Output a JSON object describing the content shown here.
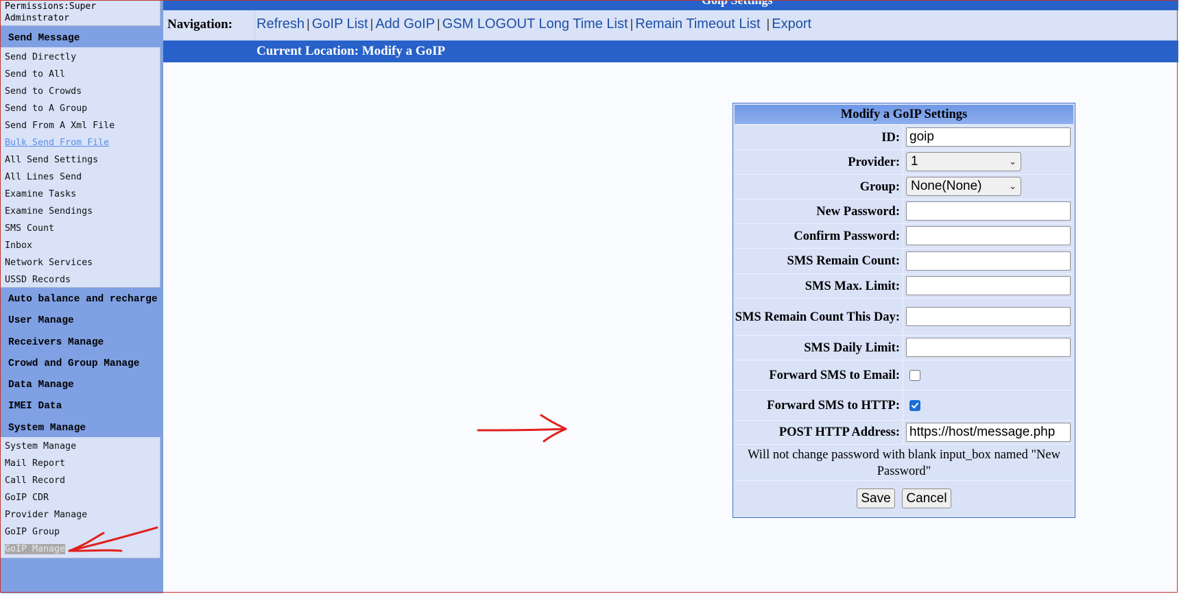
{
  "sidebar": {
    "permissions_line1": "Permissions:Super",
    "permissions_line2": "Adminstrator",
    "send_message": {
      "heading": "Send Message",
      "items": [
        {
          "label": "Send Directly"
        },
        {
          "label": "Send to All"
        },
        {
          "label": "Send to Crowds"
        },
        {
          "label": "Send to A Group"
        },
        {
          "label": "Send From A Xml File"
        },
        {
          "label": "Bulk Send From File"
        },
        {
          "label": "All Send Settings"
        },
        {
          "label": "All Lines Send"
        },
        {
          "label": "Examine Tasks"
        },
        {
          "label": "Examine Sendings"
        },
        {
          "label": "SMS Count"
        },
        {
          "label": "Inbox"
        },
        {
          "label": "Network Services"
        },
        {
          "label": "USSD Records"
        }
      ]
    },
    "headings": [
      "Auto balance and recharge",
      "User Manage",
      "Receivers Manage",
      "Crowd and Group Manage",
      "Data Manage",
      "IMEI Data",
      "System Manage"
    ],
    "system_manage_items": [
      {
        "label": "System Manage"
      },
      {
        "label": "Mail Report"
      },
      {
        "label": "Call Record"
      },
      {
        "label": "GoIP CDR"
      },
      {
        "label": "Provider Manage"
      },
      {
        "label": "GoIP Group"
      },
      {
        "label": "GoIP Manage"
      }
    ]
  },
  "header": {
    "title": "Goip Settings",
    "nav_label": "Navigation:",
    "nav_links": [
      "Refresh",
      "GoIP List",
      "Add GoIP",
      "GSM LOGOUT Long Time List",
      "Remain Timeout List",
      "Export"
    ],
    "current_location": "Current Location: Modify a GoIP"
  },
  "form": {
    "title": "Modify a GoIP Settings",
    "id_label": "ID:",
    "id_value": "goip",
    "provider_label": "Provider:",
    "provider_value": "1",
    "group_label": "Group:",
    "group_value": "None(None)",
    "new_password_label": "New Password:",
    "confirm_password_label": "Confirm Password:",
    "sms_remain_count_label": "SMS Remain Count:",
    "sms_max_limit_label": "SMS Max. Limit:",
    "sms_remain_day_label": "SMS Remain Count This Day:",
    "sms_daily_limit_label": "SMS Daily Limit:",
    "forward_email_label": "Forward SMS to Email:",
    "forward_email_checked": false,
    "forward_http_label": "Forward SMS to HTTP:",
    "forward_http_checked": true,
    "post_http_label": "POST HTTP Address:",
    "post_http_value": "https://host/message.php",
    "note": "Will not change password with blank input_box named \"New Password\"",
    "save_label": "Save",
    "cancel_label": "Cancel"
  },
  "colors": {
    "sidebar_bg": "#7fa0e3",
    "list_bg": "#d9e2f7",
    "header_blue": "#2761c9",
    "annotation_red": "#e0201f",
    "checkbox_blue": "#1a6fd6"
  }
}
